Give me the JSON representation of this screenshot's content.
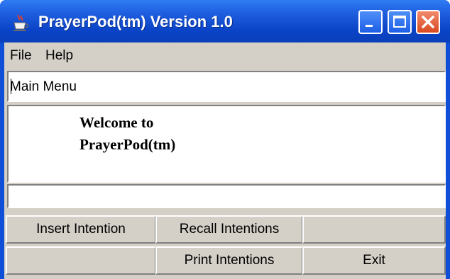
{
  "window": {
    "title": "PrayerPod(tm) Version 1.0",
    "icon": "java-cup-icon"
  },
  "menubar": {
    "items": [
      {
        "label": "File"
      },
      {
        "label": "Help"
      }
    ]
  },
  "main_menu_field": {
    "value": "Main Menu"
  },
  "welcome": {
    "line1": "Welcome to",
    "line2": "PrayerPod(tm)"
  },
  "status_field": {
    "value": ""
  },
  "buttons": {
    "insert_intention": "Insert Intention",
    "recall_intentions": "Recall Intentions",
    "print_intentions": "Print Intentions",
    "exit": "Exit"
  },
  "colors": {
    "titlebar": "#0a3fb8",
    "client_bg": "#d4d0c8",
    "close_button": "#d84a20"
  }
}
